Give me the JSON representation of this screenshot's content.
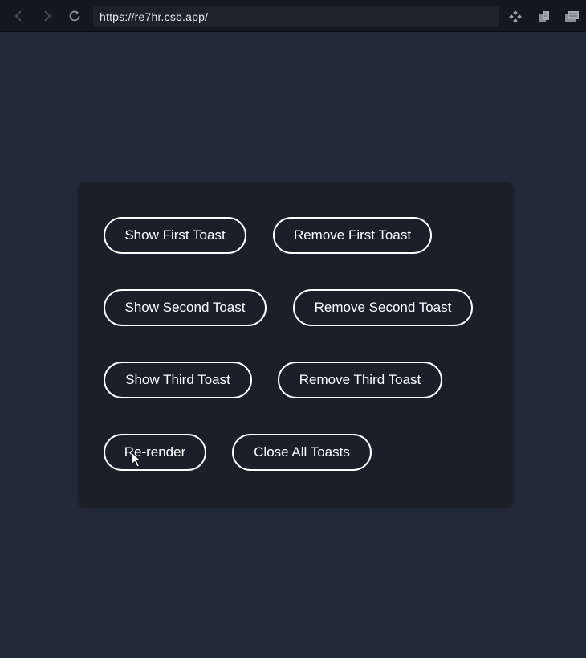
{
  "browser": {
    "url": "https://re7hr.csb.app/",
    "back_icon": "chevron-left-icon",
    "forward_icon": "chevron-right-icon",
    "reload_icon": "reload-icon",
    "extension_icons": [
      "puzzle-icon",
      "book-icon",
      "screen-icon"
    ]
  },
  "buttons": {
    "show_first": "Show First Toast",
    "remove_first": "Remove First Toast",
    "show_second": "Show Second Toast",
    "remove_second": "Remove Second Toast",
    "show_third": "Show Third Toast",
    "remove_third": "Remove Third Toast",
    "rerender": "Re-render",
    "close_all": "Close All Toasts"
  },
  "colors": {
    "page_background": "#222a39",
    "card_background": "#1a1f29",
    "button_border": "#ffffff",
    "button_text": "#ffffff"
  }
}
